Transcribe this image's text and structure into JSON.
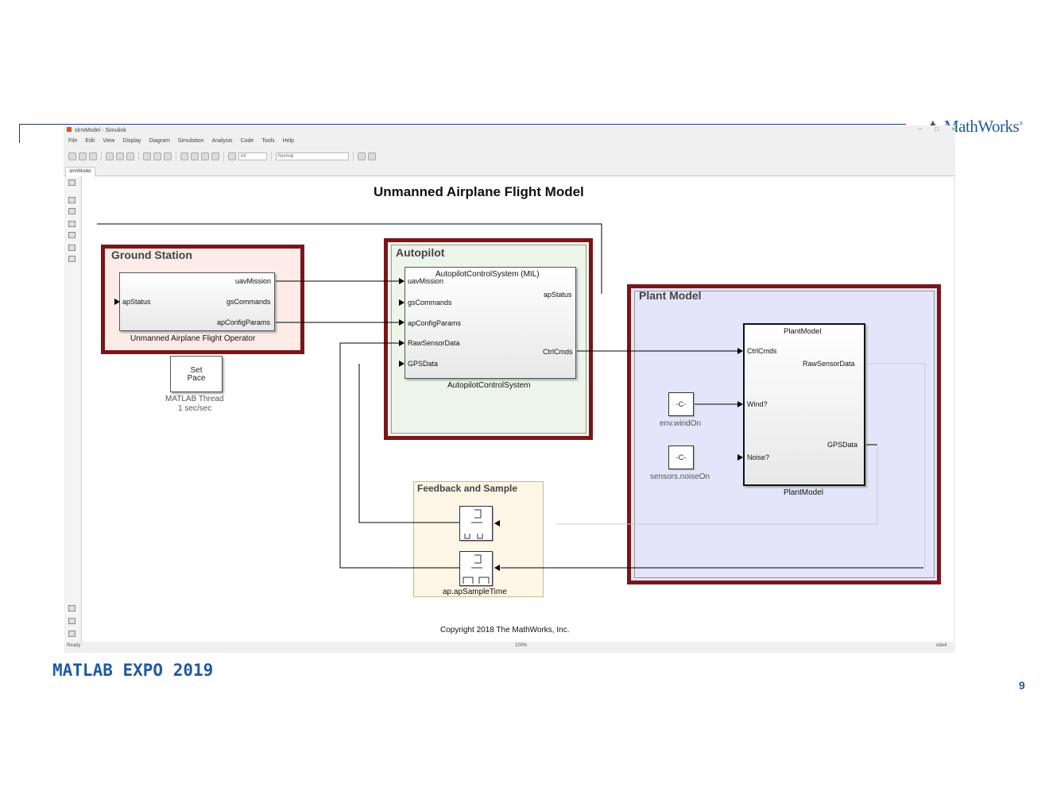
{
  "slide": {
    "logo_text": "MathWorks",
    "logo_reg": "®",
    "footer_event": "MATLAB EXPO 2019",
    "page_number": "9"
  },
  "window": {
    "title": "slrmModel - Simulink",
    "controls": [
      "–",
      "□",
      "×"
    ],
    "menu": [
      "File",
      "Edit",
      "View",
      "Display",
      "Diagram",
      "Simulation",
      "Analysis",
      "Code",
      "Tools",
      "Help"
    ],
    "stop_time": "inf",
    "sim_mode": "Normal",
    "tab_label": "slrmModel",
    "status_left": "Ready",
    "status_center": "100%",
    "status_right": "ode4"
  },
  "diagram": {
    "title": "Unmanned Airplane Flight Model",
    "copyright": "Copyright 2018 The MathWorks, Inc.",
    "ground_station": {
      "label": "Ground Station",
      "block_name": "Unmanned Airplane Flight Operator",
      "in_ports": [
        "apStatus"
      ],
      "out_ports": [
        "uavMission",
        "gsCommands",
        "apConfigParams"
      ]
    },
    "set_pace": {
      "line1": "Set",
      "line2": "Pace",
      "caption1": "MATLAB Thread",
      "caption2": "1 sec/sec"
    },
    "autopilot": {
      "label": "Autopilot",
      "block_title": "AutopilotControlSystem (MIL)",
      "block_name": "AutopilotControlSystem",
      "in_ports": [
        "uavMission",
        "gsCommands",
        "apConfigParams",
        "RawSensorData",
        "GPSData"
      ],
      "out_ports": [
        "apStatus",
        "CtrlCmds"
      ]
    },
    "plant": {
      "label": "Plant Model",
      "block_title": "PlantModel",
      "block_name": "PlantModel",
      "in_ports": [
        "CtrlCmds",
        "Wind?",
        "Noise?"
      ],
      "out_ports": [
        "RawSensorData",
        "GPSData"
      ],
      "const_wind": "-C-",
      "const_wind_name": "env.windOn",
      "const_noise": "-C-",
      "const_noise_name": "sensors.noiseOn"
    },
    "feedback": {
      "label": "Feedback and Sample",
      "rt_caption": "ap.apSampleTime"
    }
  }
}
